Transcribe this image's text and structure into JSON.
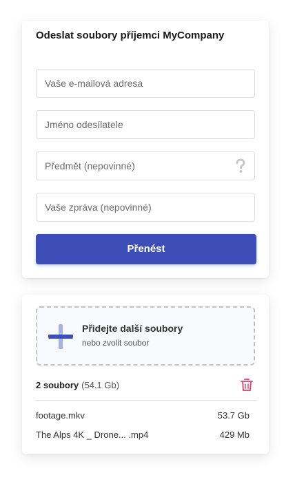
{
  "form": {
    "title": "Odeslat soubory příjemci MyCompany",
    "email_placeholder": "Vaše e-mailová adresa",
    "sender_placeholder": "Jméno odesílatele",
    "subject_placeholder": "Předmět (nepovinné)",
    "message_placeholder": "Vaše zpráva (nepovinné)",
    "help_icon": "question-mark-icon",
    "submit_label": "Přenést",
    "accent_color": "#3d4eb8"
  },
  "upload": {
    "drop_title": "Přidejte další soubory",
    "drop_subtitle": "nebo zvolit soubor",
    "add_icon": "plus-icon",
    "delete_icon": "trash-icon",
    "delete_color": "#e0517a",
    "summary_count": "2 soubory",
    "summary_size": "(54.1 Gb)",
    "files": [
      {
        "name": "footage.mkv",
        "size": "53.7 Gb"
      },
      {
        "name": "The Alps 4K _ Drone... .mp4",
        "size": "429 Mb"
      }
    ]
  }
}
